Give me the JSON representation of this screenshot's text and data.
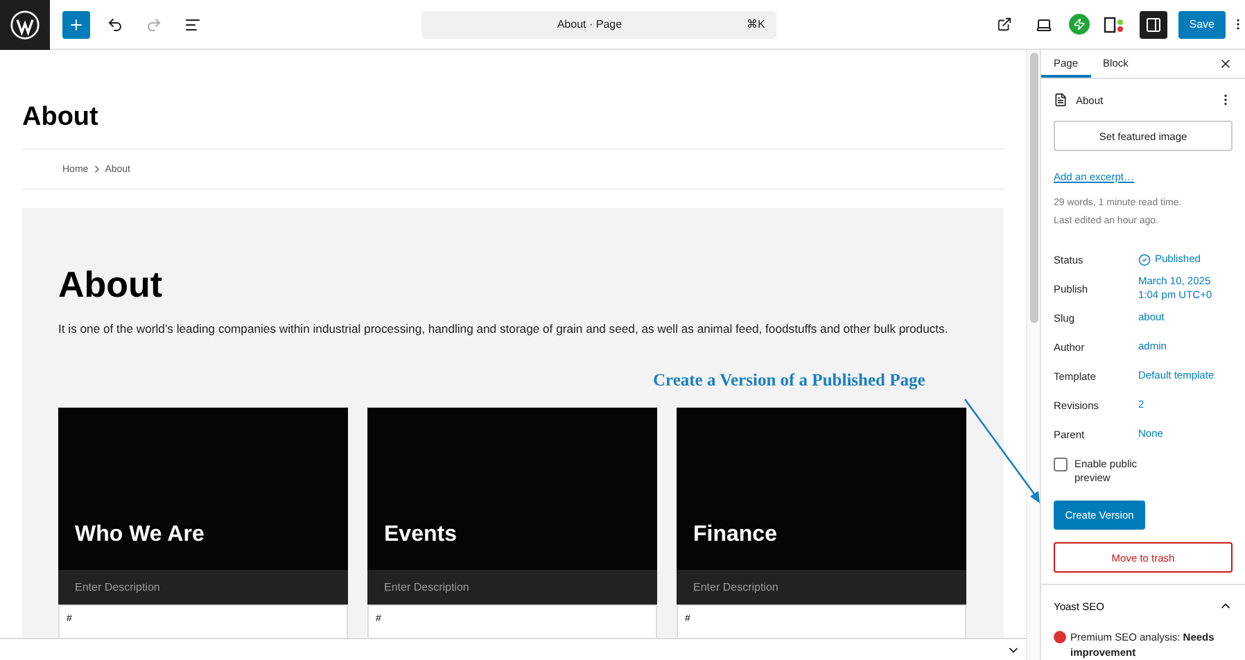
{
  "toolbar": {
    "document_title": "About · Page",
    "shortcut": "⌘K",
    "save_label": "Save"
  },
  "content": {
    "page_title": "About",
    "breadcrumb": [
      "Home",
      "About"
    ],
    "heading": "About",
    "paragraph": "It is one of the world’s leading companies within industrial processing, handling and storage of grain and seed, as well as animal feed, foodstuffs and other bulk products.",
    "cards": [
      {
        "title": "Who We Are",
        "description": "Enter Description",
        "footer": "#"
      },
      {
        "title": "Events",
        "description": "Enter Description",
        "footer": "#"
      },
      {
        "title": "Finance",
        "description": "Enter Description",
        "footer": "#"
      }
    ]
  },
  "annotation": "Create a Version of a Published Page",
  "sidebar": {
    "tabs": [
      {
        "label": "Page",
        "selected": true
      },
      {
        "label": "Block",
        "selected": false
      }
    ],
    "document": "About",
    "featured_button": "Set featured image",
    "excerpt_link": "Add an excerpt…",
    "stats": [
      "29 words, 1 minute read time.",
      "Last edited an hour ago."
    ],
    "fields": [
      {
        "label": "Status",
        "value": "Published",
        "kind": "status"
      },
      {
        "label": "Publish",
        "value": "March 10, 2025 1:04 pm UTC+0",
        "kind": "link"
      },
      {
        "label": "Slug",
        "value": "about",
        "kind": "link"
      },
      {
        "label": "Author",
        "value": "admin",
        "kind": "link"
      },
      {
        "label": "Template",
        "value": "Default template",
        "kind": "link"
      },
      {
        "label": "Revisions",
        "value": "2",
        "kind": "link"
      },
      {
        "label": "Parent",
        "value": "None",
        "kind": "link"
      }
    ],
    "public_preview": {
      "label": "Enable public preview",
      "checked": false
    },
    "create_version": "Create Version",
    "trash": "Move to trash",
    "yoast": {
      "title": "Yoast SEO",
      "expanded": true,
      "analysis": "Premium SEO analysis: **Needs improvement**"
    }
  }
}
